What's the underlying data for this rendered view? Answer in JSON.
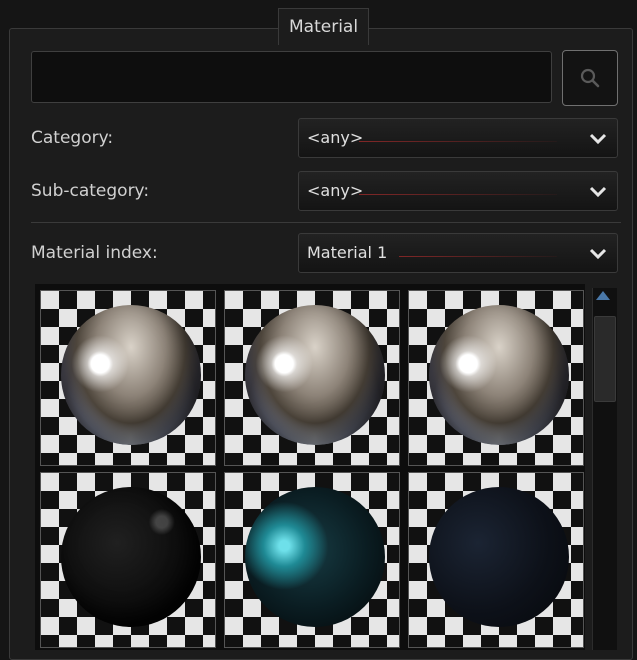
{
  "panel": {
    "title": "Material"
  },
  "search": {
    "value": "",
    "placeholder": "",
    "icon": "search-icon"
  },
  "filters": {
    "category": {
      "label": "Category:",
      "value": "<any>"
    },
    "sub_category": {
      "label": "Sub-category:",
      "value": "<any>"
    },
    "material_index": {
      "label": "Material index:",
      "value": "Material 1"
    }
  },
  "materials": [
    {
      "type": "chrome"
    },
    {
      "type": "chrome"
    },
    {
      "type": "chrome"
    },
    {
      "type": "dark-glossy"
    },
    {
      "type": "dark-teal"
    },
    {
      "type": "dark-navy"
    }
  ],
  "colors": {
    "background": "#1c1c1c",
    "dropdown_accent": "#8c2828",
    "scroll_arrow": "#4a78a8"
  }
}
